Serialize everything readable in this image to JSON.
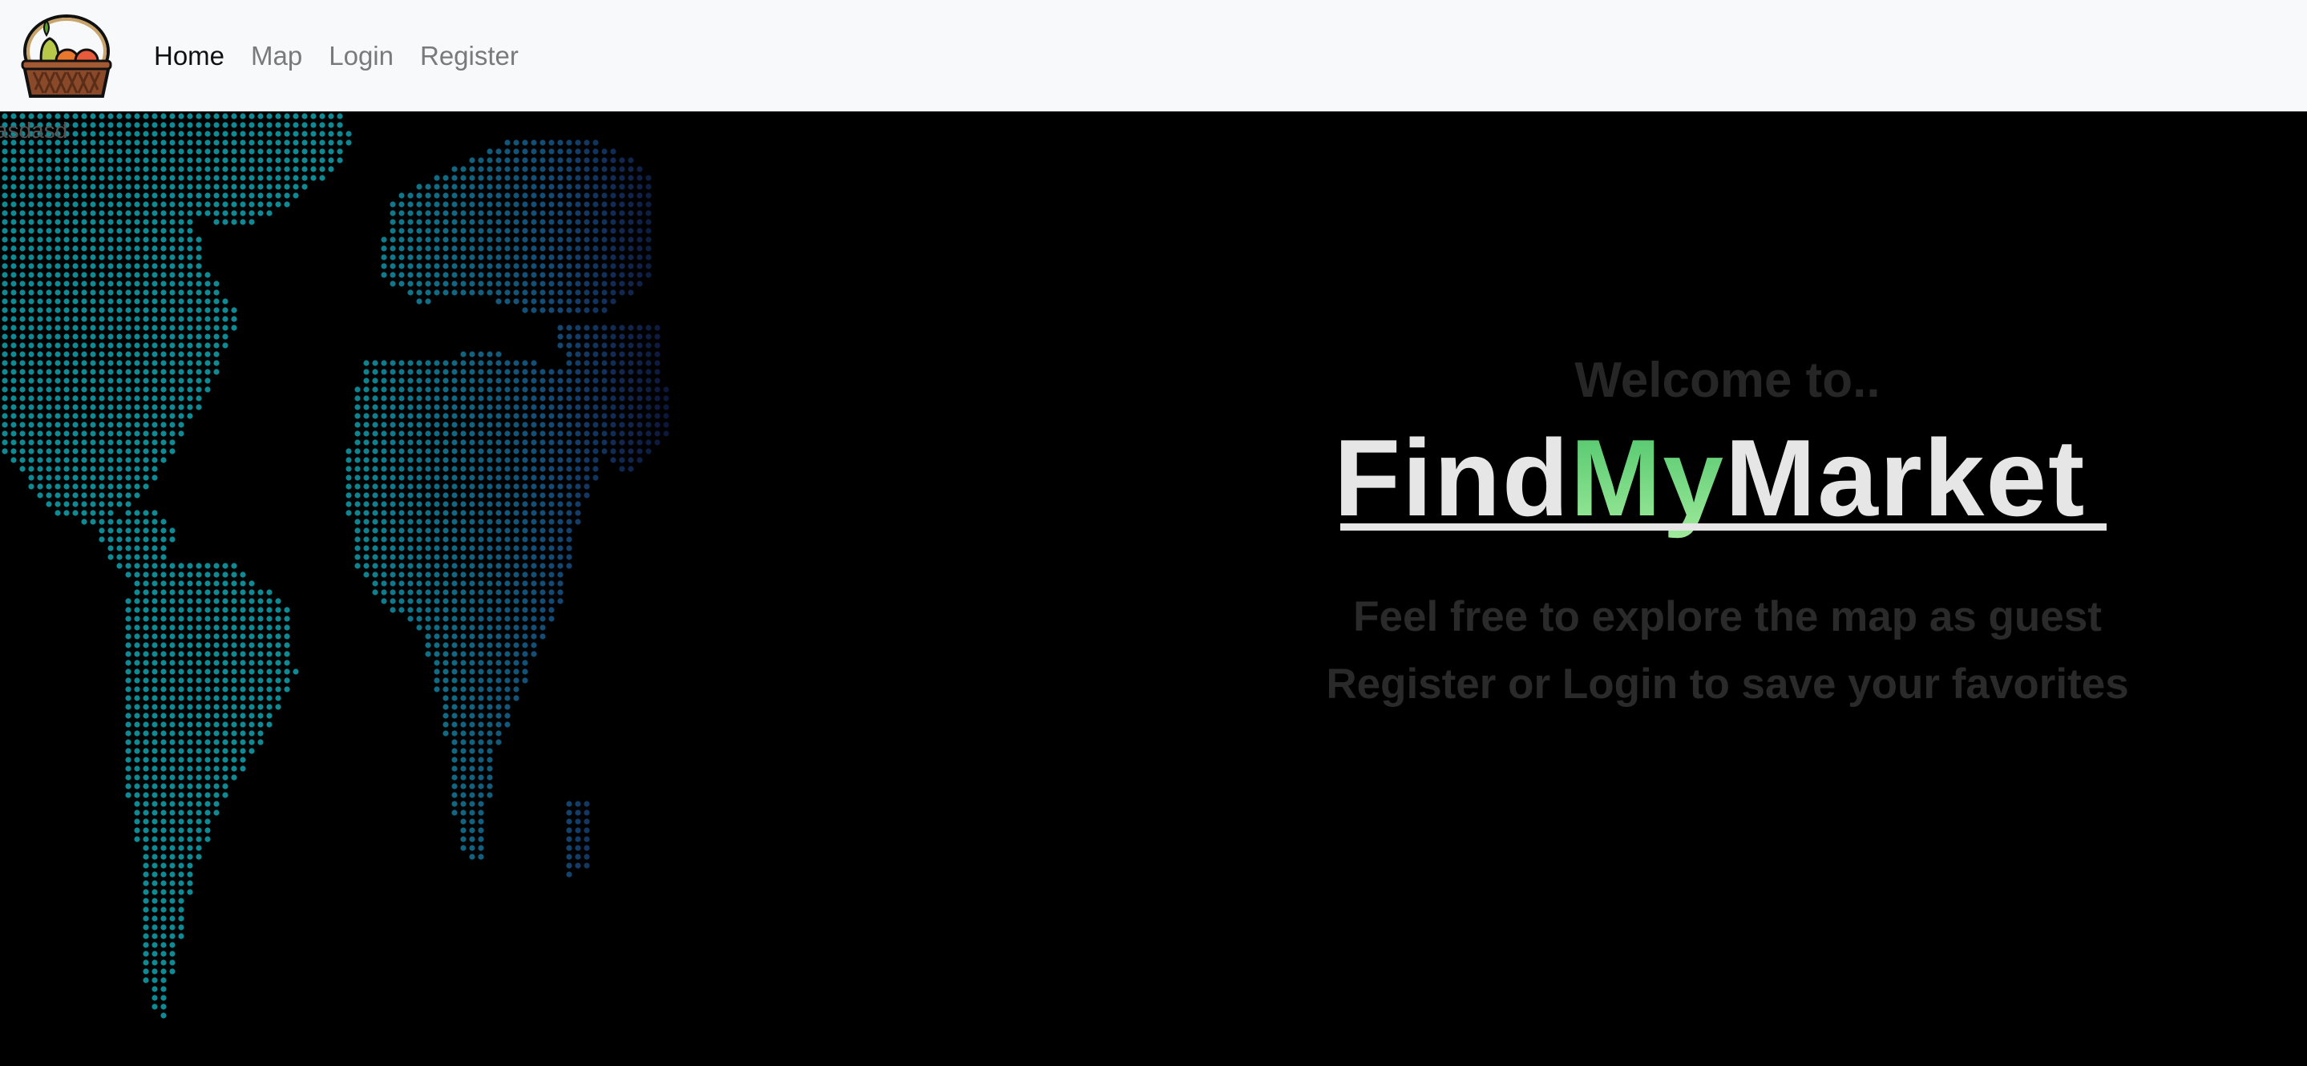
{
  "nav": {
    "logo_icon": "fruit-basket-icon",
    "links": [
      {
        "label": "Home",
        "active": true
      },
      {
        "label": "Map",
        "active": false
      },
      {
        "label": "Login",
        "active": false
      },
      {
        "label": "Register",
        "active": false
      }
    ]
  },
  "hero": {
    "stray_text": "asdasd",
    "welcome": "Welcome to..",
    "brand": {
      "part1": "Find",
      "part2": "My",
      "part3": "Market"
    },
    "tagline1": "Feel free to explore the map as guest",
    "tagline2": "Register or Login to save your favorites",
    "colors": {
      "background": "#000000",
      "navbar": "#f8f9fa",
      "map_teal": "#0e8a94",
      "map_blue": "#1b2a66",
      "brand_white": "#e6e6e6",
      "brand_green": "#6ad27a",
      "muted_text": "#262626"
    }
  }
}
